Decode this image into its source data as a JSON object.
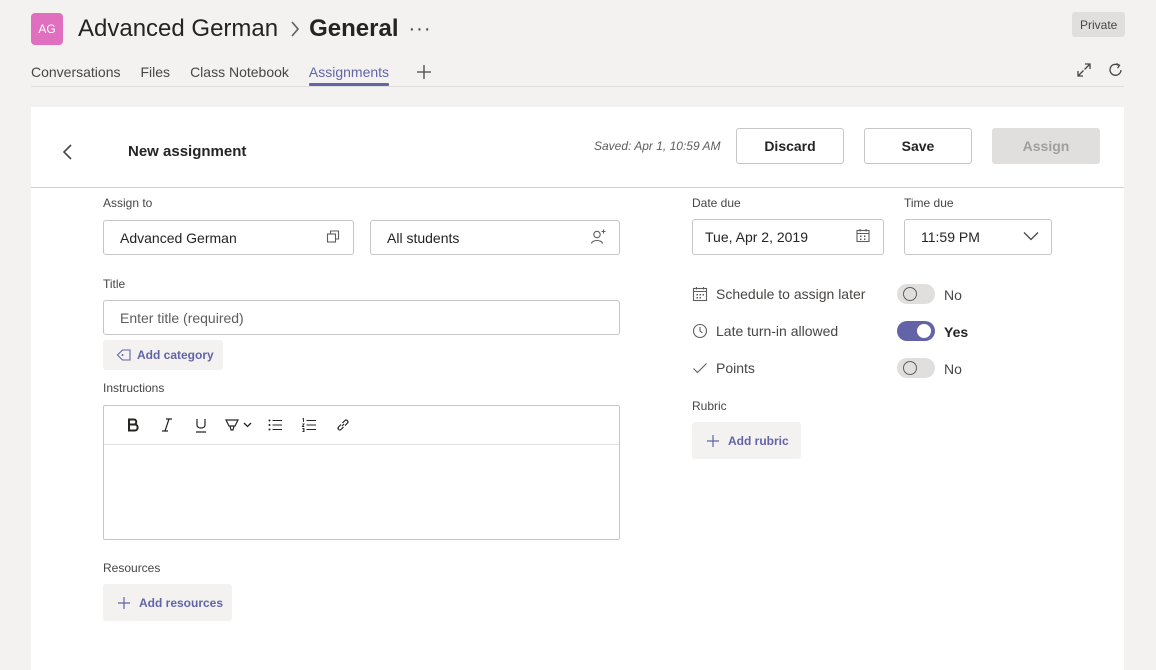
{
  "header": {
    "avatar_initials": "AG",
    "team_name": "Advanced German",
    "channel_name": "General",
    "more": "···",
    "privacy_badge": "Private"
  },
  "tabs": [
    {
      "label": "Conversations",
      "active": false
    },
    {
      "label": "Files",
      "active": false
    },
    {
      "label": "Class Notebook",
      "active": false
    },
    {
      "label": "Assignments",
      "active": true
    }
  ],
  "panel": {
    "title": "New assignment",
    "saved_status": "Saved: Apr 1, 10:59 AM",
    "discard_label": "Discard",
    "save_label": "Save",
    "assign_label": "Assign"
  },
  "form": {
    "assign_to_label": "Assign to",
    "class_value": "Advanced German",
    "students_value": "All students",
    "title_label": "Title",
    "title_placeholder": "Enter title (required)",
    "add_category_label": "Add category",
    "instructions_label": "Instructions",
    "resources_label": "Resources",
    "add_resources_label": "Add resources"
  },
  "schedule": {
    "date_due_label": "Date due",
    "date_due_value": "Tue, Apr 2, 2019",
    "time_due_label": "Time due",
    "time_due_value": "11:59 PM",
    "options": [
      {
        "label": "Schedule to assign later",
        "state": "No",
        "on": false
      },
      {
        "label": "Late turn-in allowed",
        "state": "Yes",
        "on": true
      },
      {
        "label": "Points",
        "state": "No",
        "on": false
      }
    ],
    "rubric_label": "Rubric",
    "add_rubric_label": "Add rubric"
  },
  "colors": {
    "accent": "#6264a7",
    "avatar": "#e06fbf"
  }
}
